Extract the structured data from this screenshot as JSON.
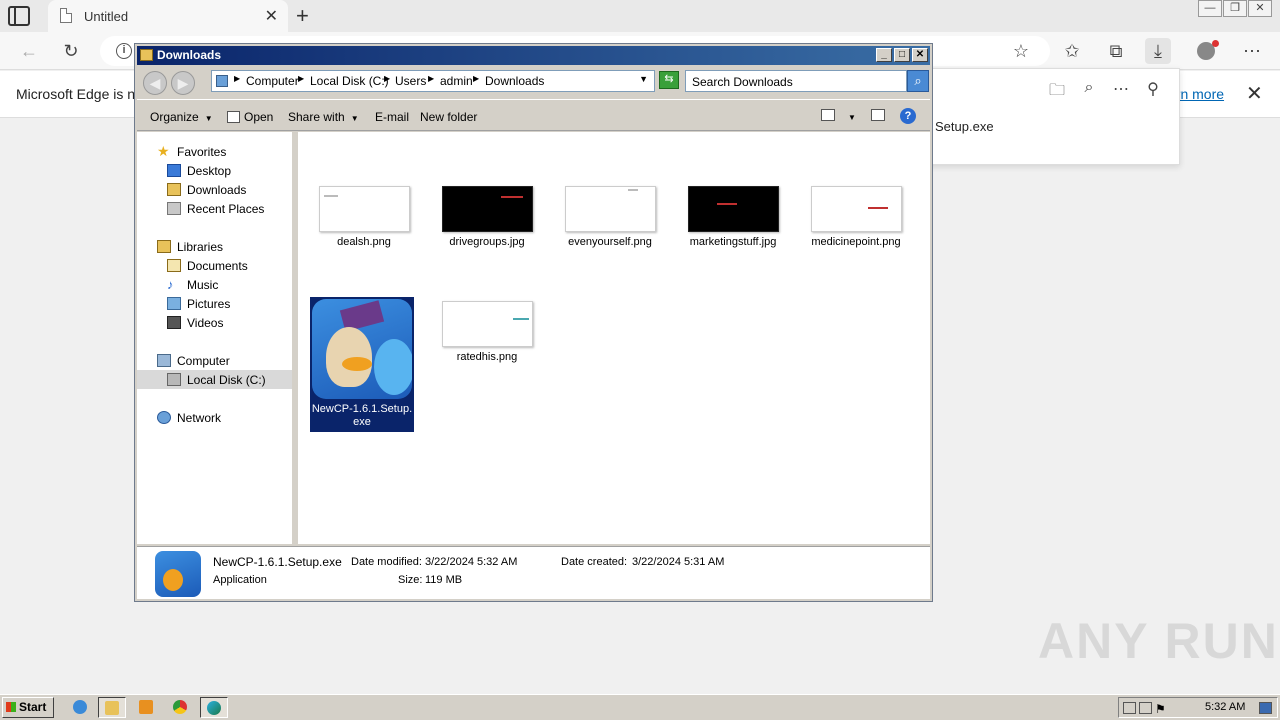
{
  "browser": {
    "tab_title": "Untitled",
    "tab_close": "✕",
    "new_tab": "+",
    "window_controls": [
      "—",
      "❐",
      "✕"
    ],
    "infobar": {
      "message": "Microsoft Edge is no",
      "link": "arn more",
      "close": "✕"
    },
    "download_panel": {
      "filename": "Setup.exe"
    }
  },
  "explorer": {
    "title": "Downloads",
    "title_controls": [
      "_",
      "□",
      "✕"
    ],
    "breadcrumb": [
      "Computer",
      "Local Disk (C:)",
      "Users",
      "admin",
      "Downloads"
    ],
    "search_placeholder": "Search Downloads",
    "commands": {
      "organize": "Organize",
      "open": "Open",
      "share_with": "Share with",
      "email": "E-mail",
      "new_folder": "New folder"
    },
    "nav": {
      "favorites": "Favorites",
      "desktop": "Desktop",
      "downloads": "Downloads",
      "recent_places": "Recent Places",
      "libraries": "Libraries",
      "documents": "Documents",
      "music": "Music",
      "pictures": "Pictures",
      "videos": "Videos",
      "computer": "Computer",
      "local_disk": "Local Disk (C:)",
      "network": "Network"
    },
    "files": [
      {
        "name": "dealsh.png"
      },
      {
        "name": "drivegroups.jpg"
      },
      {
        "name": "evenyourself.png"
      },
      {
        "name": "marketingstuff.jpg"
      },
      {
        "name": "medicinepoint.png"
      },
      {
        "name": "NewCP-1.6.1.Setup.exe"
      },
      {
        "name": "ratedhis.png"
      }
    ],
    "details": {
      "filename": "NewCP-1.6.1.Setup.exe",
      "type": "Application",
      "modified_label": "Date modified:",
      "modified": "3/22/2024 5:32 AM",
      "created_label": "Date created:",
      "created": "3/22/2024 5:31 AM",
      "size_label": "Size:",
      "size": "119 MB"
    }
  },
  "taskbar": {
    "start": "Start",
    "clock": "5:32 AM"
  },
  "watermark": "ANY RUN"
}
